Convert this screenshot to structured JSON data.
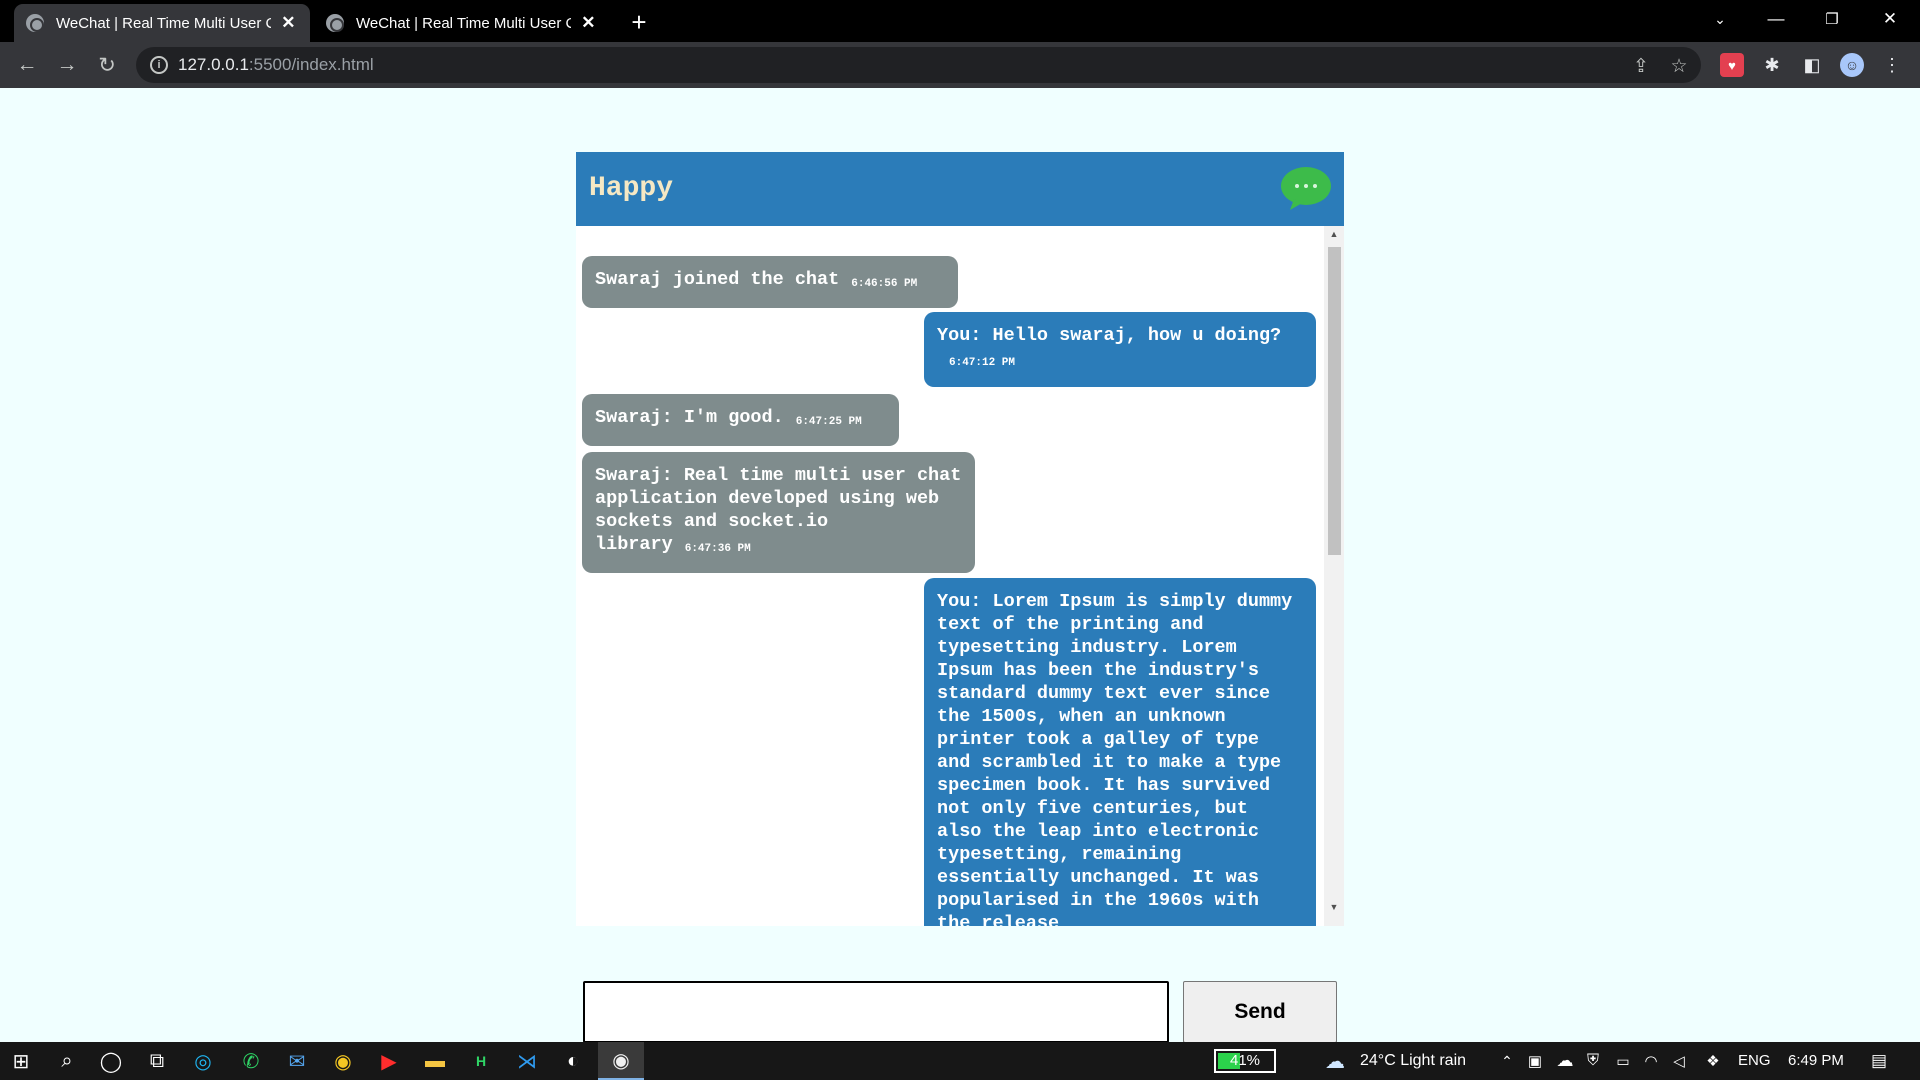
{
  "browser": {
    "tabs": [
      {
        "title": "WeChat | Real Time Multi User Chat",
        "active": true
      },
      {
        "title": "WeChat | Real Time Multi User Chat",
        "active": false
      }
    ],
    "url_host": "127.0.0.1",
    "url_path": ":5500/index.html"
  },
  "chat": {
    "title": "Happy",
    "messages": [
      {
        "sender": "Swaraj",
        "text": "Swaraj joined the chat",
        "time": "6:46:56 PM",
        "direction": "incoming"
      },
      {
        "sender": "You",
        "text": "You: Hello swaraj, how u doing?",
        "time": "6:47:12 PM",
        "direction": "outgoing"
      },
      {
        "sender": "Swaraj",
        "text": "Swaraj: I'm good.",
        "time": "6:47:25 PM",
        "direction": "incoming"
      },
      {
        "sender": "Swaraj",
        "text": "Swaraj: Real time multi user chat application developed using web sockets and socket.io library",
        "time": "6:47:36 PM",
        "direction": "incoming"
      },
      {
        "sender": "You",
        "text": "You: Lorem Ipsum is simply dummy text of the printing and typesetting industry. Lorem Ipsum has been the industry's standard dummy text ever since the 1500s, when an unknown printer took a galley of type and scrambled it to make a type specimen book. It has survived not only five centuries, but also the leap into electronic typesetting, remaining essentially unchanged. It was popularised in the 1960s with the release",
        "time": "",
        "direction": "outgoing"
      }
    ],
    "input_value": "",
    "send_label": "Send"
  },
  "taskbar": {
    "battery": "41%",
    "weather": "24°C  Light rain",
    "language": "ENG",
    "clock": "6:49 PM"
  },
  "colors": {
    "header": "#2b7cb9",
    "title_text": "#f5e8c4",
    "incoming_bubble": "#7f8c8d",
    "outgoing_bubble": "#2b7cb9",
    "page_bg": "#f0ffff",
    "logo_green": "#3dbb4a"
  }
}
